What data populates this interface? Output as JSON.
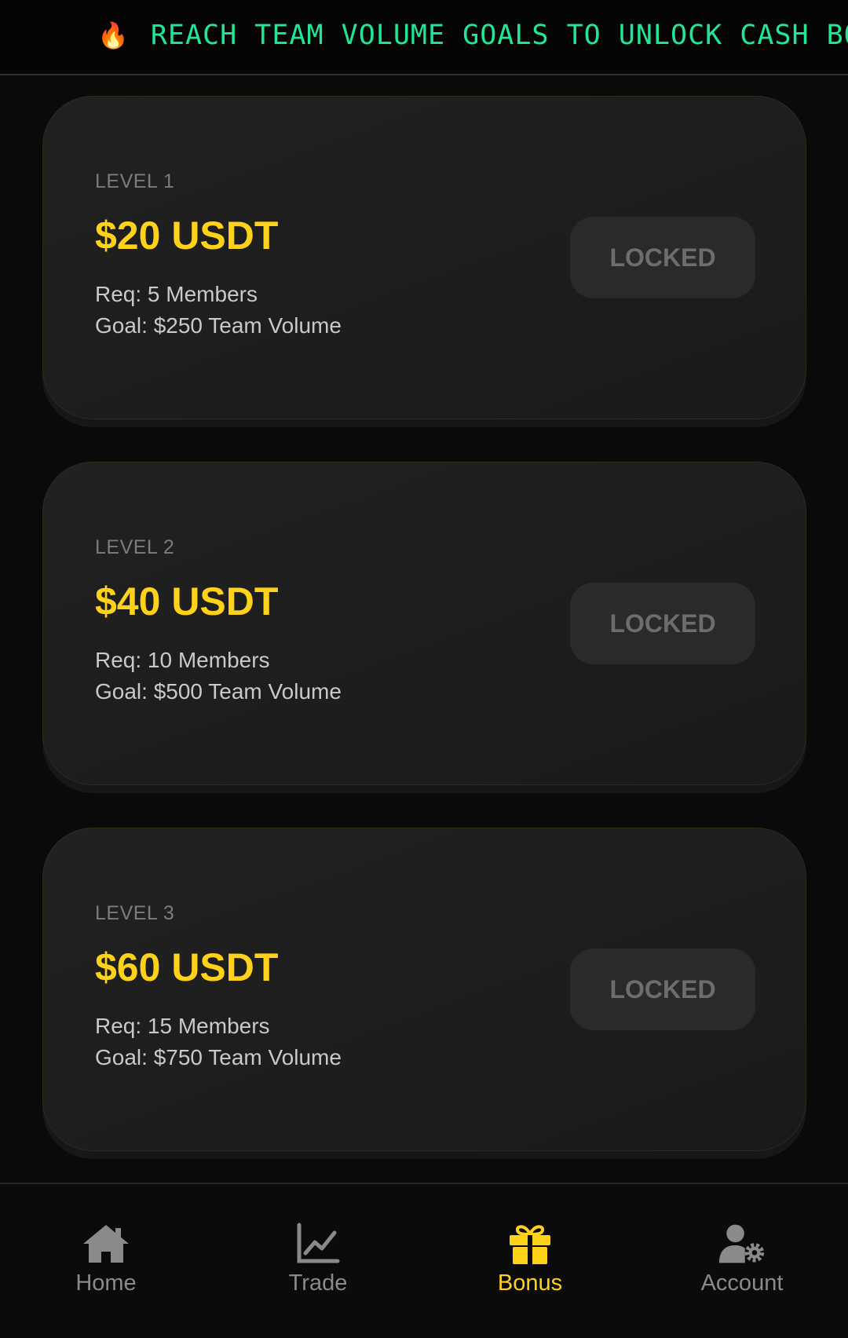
{
  "ticker": {
    "icon": "fire-icon",
    "text": "REACH TEAM VOLUME GOALS TO UNLOCK CASH BO"
  },
  "levels": [
    {
      "level": "LEVEL 1",
      "amount": "$20 USDT",
      "req": "Req: 5 Members",
      "goal": "Goal: $250 Team Volume",
      "status": "LOCKED"
    },
    {
      "level": "LEVEL 2",
      "amount": "$40 USDT",
      "req": "Req: 10 Members",
      "goal": "Goal: $500 Team Volume",
      "status": "LOCKED"
    },
    {
      "level": "LEVEL 3",
      "amount": "$60 USDT",
      "req": "Req: 15 Members",
      "goal": "Goal: $750 Team Volume",
      "status": "LOCKED"
    }
  ],
  "nav": {
    "items": [
      {
        "label": "Home",
        "icon": "home-icon"
      },
      {
        "label": "Trade",
        "icon": "chart-line-icon"
      },
      {
        "label": "Bonus",
        "icon": "gift-icon",
        "active": true
      },
      {
        "label": "Account",
        "icon": "user-gear-icon"
      }
    ]
  },
  "colors": {
    "accent": "#ffd21a",
    "ticker_text": "#1ee896",
    "background": "#0a0a0a",
    "card": "#1e1e1e",
    "locked_button": "#2a2a2a"
  }
}
